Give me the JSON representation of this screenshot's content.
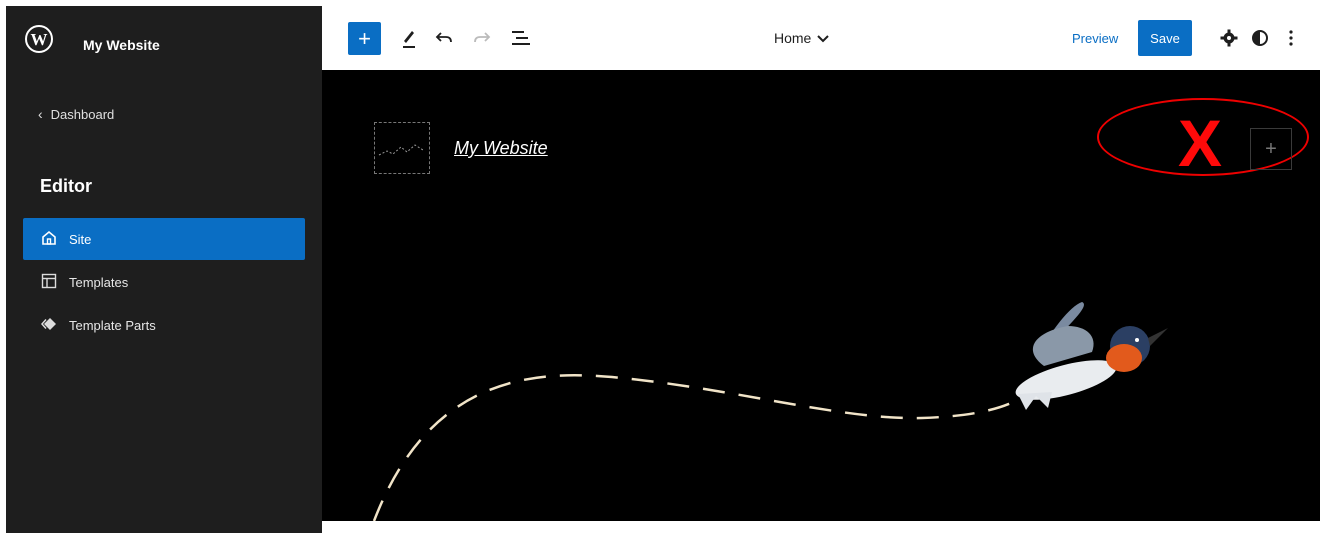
{
  "sidebar": {
    "site_name": "My Website",
    "back_label": "Dashboard",
    "section_title": "Editor",
    "items": [
      {
        "label": "Site",
        "active": true
      },
      {
        "label": "Templates",
        "active": false
      },
      {
        "label": "Template Parts",
        "active": false
      }
    ]
  },
  "toolbar": {
    "add_label": "+",
    "doc_title": "Home",
    "preview_label": "Preview",
    "save_label": "Save"
  },
  "canvas": {
    "site_title": "My Website",
    "inserter_label": "+",
    "annotation_mark": "X",
    "background": "#000000"
  },
  "colors": {
    "accent": "#0a6ec4",
    "sidebar_bg": "#1e1e1e",
    "annotation": "#ff0a0a"
  }
}
